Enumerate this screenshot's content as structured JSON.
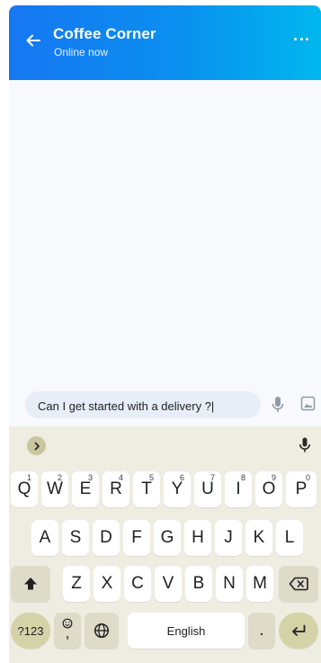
{
  "header": {
    "title": "Coffee Corner",
    "status": "Online now"
  },
  "composer": {
    "message_text": "Can I get started with a delivery ?|"
  },
  "keyboard": {
    "row1": [
      {
        "label": "Q",
        "hint": "1"
      },
      {
        "label": "W",
        "hint": "2"
      },
      {
        "label": "E",
        "hint": "3"
      },
      {
        "label": "R",
        "hint": "4"
      },
      {
        "label": "T",
        "hint": "5"
      },
      {
        "label": "Y",
        "hint": "6"
      },
      {
        "label": "U",
        "hint": "7"
      },
      {
        "label": "I",
        "hint": "8"
      },
      {
        "label": "O",
        "hint": "9"
      },
      {
        "label": "P",
        "hint": "0"
      }
    ],
    "row2": [
      "A",
      "S",
      "D",
      "F",
      "G",
      "H",
      "J",
      "K",
      "L"
    ],
    "row3": [
      "Z",
      "X",
      "C",
      "V",
      "B",
      "N",
      "M"
    ],
    "symbols_label": "?123",
    "emoji_comma_label": ",",
    "space_label": "English",
    "period_label": "."
  },
  "colors": {
    "header_gradient_start": "#1677f2",
    "header_gradient_end": "#00b7ee",
    "keyboard_bg": "#efede2",
    "accent_key": "#d4d3a8"
  }
}
